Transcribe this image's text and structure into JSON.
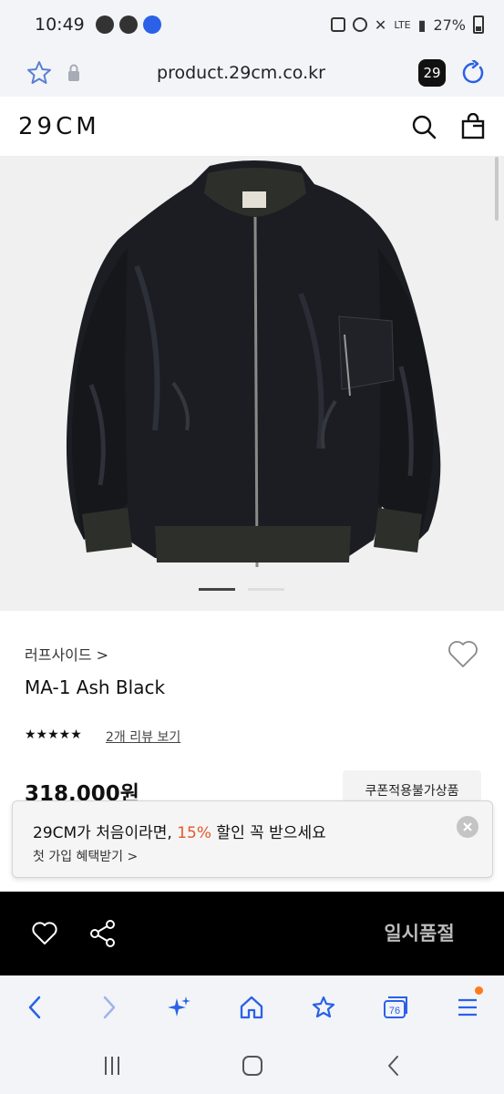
{
  "status_bar": {
    "time": "10:49",
    "network": "LTE",
    "battery": "27%"
  },
  "browser": {
    "url": "product.29cm.co.kr",
    "tab_count": "29",
    "bottom_tab_count": "76"
  },
  "site": {
    "logo": "29CM"
  },
  "product": {
    "brand": "러프사이드 >",
    "name": "MA-1 Ash Black",
    "rating_stars": "★★★★★",
    "rating_value": 5,
    "review_link": "2개 리뷰 보기",
    "price": "318,000원",
    "coupon_label": "쿠폰적용불가상품",
    "image_count": 2,
    "active_image_index": 1
  },
  "promo": {
    "line1_prefix": "29CM가 처음이라면, ",
    "line1_accent": "15%",
    "line1_suffix": " 할인 꼭 받으세요",
    "line2": "첫 가입 혜택받기 >",
    "accent_color": "#e4572e"
  },
  "buy_bar": {
    "soldout_label": "일시품절"
  },
  "icons": {
    "status": [
      "chat-icon",
      "cloud-icon",
      "app-badge-icon",
      "screenshot-icon",
      "alarm-icon",
      "mute-icon",
      "signal-icon",
      "battery-icon"
    ],
    "browser_top": [
      "bookmark-star-icon",
      "lock-icon",
      "reload-icon"
    ],
    "site_header": [
      "search-icon",
      "cart-icon"
    ],
    "browser_bottom": [
      "back-icon",
      "forward-icon",
      "sparkle-icon",
      "home-icon",
      "favorites-icon",
      "tabs-icon",
      "menu-icon"
    ],
    "system_nav": [
      "recents-icon",
      "home-icon",
      "back-icon"
    ]
  }
}
